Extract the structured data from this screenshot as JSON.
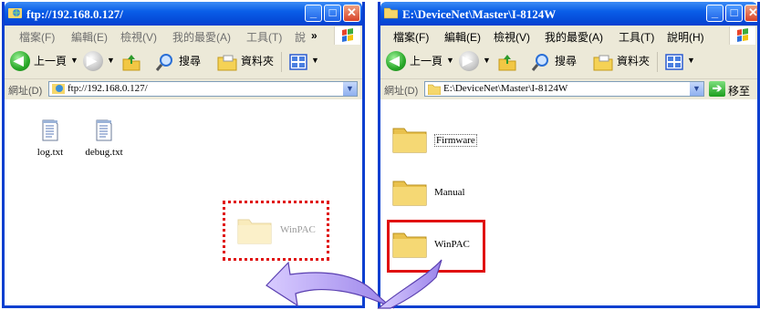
{
  "left_window": {
    "title": "ftp://192.168.0.127/",
    "menu": [
      "檔案(F)",
      "編輯(E)",
      "檢視(V)",
      "我的最愛(A)",
      "工具(T)",
      "說"
    ],
    "menu_overflow": "»",
    "toolbar": {
      "back": "上一頁",
      "search": "搜尋",
      "folders": "資料夾"
    },
    "address_label": "網址(D)",
    "address_value": "ftp://192.168.0.127/",
    "files": [
      {
        "name": "log.txt",
        "icon": "text-file-icon"
      },
      {
        "name": "debug.txt",
        "icon": "text-file-icon"
      }
    ],
    "ghost_folder": "WinPAC"
  },
  "right_window": {
    "title": "E:\\DeviceNet\\Master\\I-8124W",
    "menu": [
      "檔案(F)",
      "編輯(E)",
      "檢視(V)",
      "我的最愛(A)",
      "工具(T)",
      "說明(H)"
    ],
    "toolbar": {
      "back": "上一頁",
      "search": "搜尋",
      "folders": "資料夾"
    },
    "address_label": "網址(D)",
    "address_value": "E:\\DeviceNet\\Master\\I-8124W",
    "go_label": "移至",
    "folders": [
      {
        "name": "Firmware"
      },
      {
        "name": "Manual"
      },
      {
        "name": "WinPAC"
      }
    ]
  },
  "colors": {
    "title_bar": "#0a5ee8",
    "highlight_red": "#e01010",
    "arrow_purple": "#b9a6f5"
  }
}
